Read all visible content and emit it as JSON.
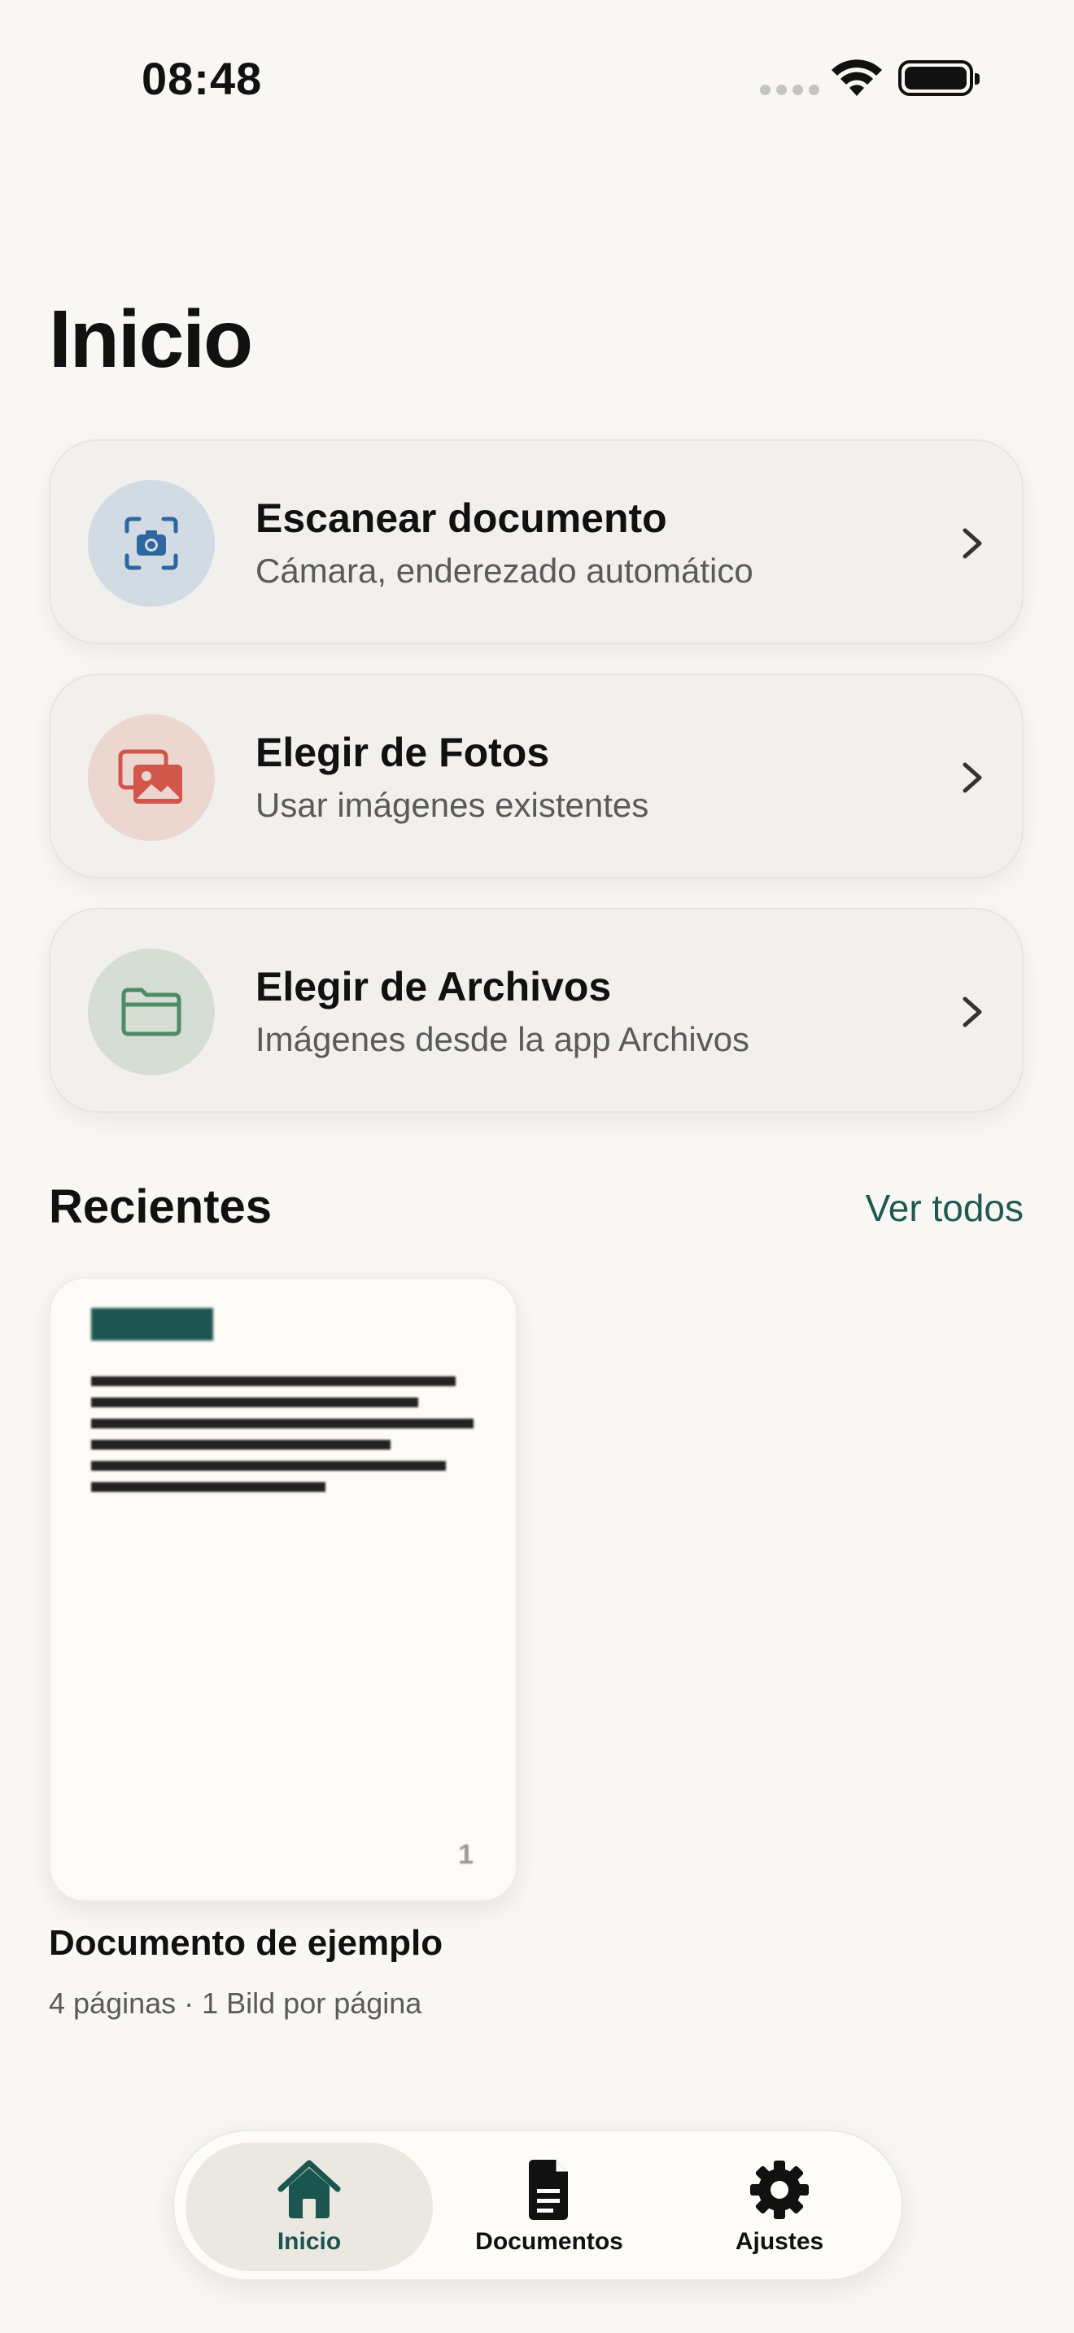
{
  "status_bar": {
    "time": "08:48"
  },
  "page": {
    "title": "Inicio"
  },
  "actions": [
    {
      "title": "Escanear documento",
      "subtitle": "Cámara, enderezado automático",
      "icon": "camera-scan-icon"
    },
    {
      "title": "Elegir de Fotos",
      "subtitle": "Usar imágenes existentes",
      "icon": "photos-icon"
    },
    {
      "title": "Elegir de Archivos",
      "subtitle": "Imágenes desde la app Archivos",
      "icon": "folder-icon"
    }
  ],
  "recents": {
    "title": "Recientes",
    "see_all": "Ver todos",
    "items": [
      {
        "name": "Documento de ejemplo",
        "meta": "4 páginas · 1 Bild por página",
        "page_number": "1"
      }
    ]
  },
  "tab_bar": {
    "tabs": [
      {
        "label": "Inicio",
        "icon": "home-icon",
        "active": true
      },
      {
        "label": "Documentos",
        "icon": "document-icon",
        "active": false
      },
      {
        "label": "Ajustes",
        "icon": "gear-icon",
        "active": false
      }
    ]
  },
  "colors": {
    "background": "#f9f7f3",
    "accent": "#1a5550",
    "scan_icon": "#2f66a0",
    "photos_icon": "#d0574a",
    "files_icon": "#4e8b66"
  }
}
